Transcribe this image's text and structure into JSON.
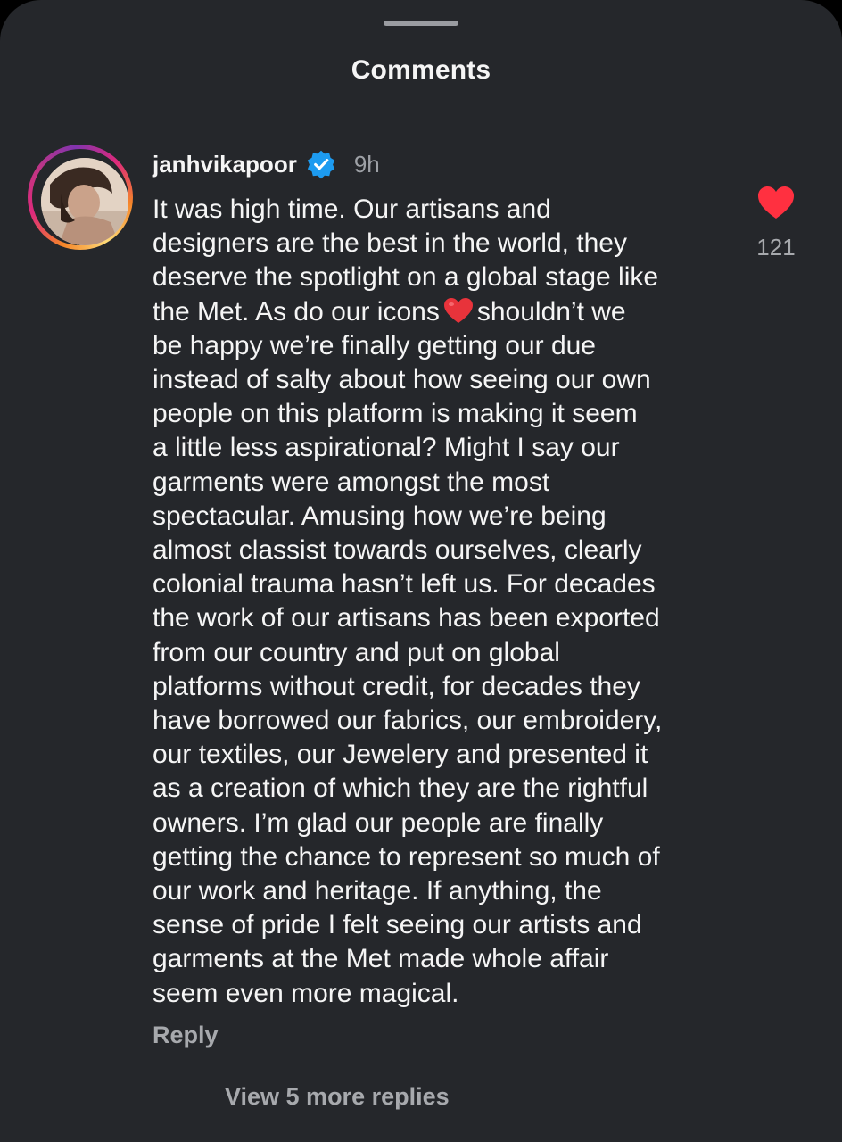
{
  "sheet": {
    "title": "Comments"
  },
  "comment": {
    "username": "janhvikapoor",
    "verified_icon": "verified-badge-icon",
    "time": "9h",
    "lines": [
      "It was high time. Our artisans and",
      "designers are the best in the world, they",
      "deserve the spotlight on a global stage like",
      "the Met. As do our icons",
      "shouldn’t we",
      "be happy we’re finally getting our due",
      "instead of salty about how seeing our own",
      "people on this platform is making it seem",
      "a little less aspirational? Might I say our",
      "garments were amongst the most",
      "spectacular. Amusing how we’re being",
      "almost classist towards ourselves, clearly",
      "colonial trauma hasn’t left us. For decades",
      "the work of our artisans has been exported",
      "from our country and put on global",
      "platforms without credit, for decades they",
      "have borrowed our fabrics, our embroidery,",
      "our textiles, our Jewelery and presented it",
      "as a creation of which they are the rightful",
      "owners. I’m glad our people are finally",
      "getting the chance to represent so much of",
      "our work and heritage. If anything, the",
      "sense of pride I felt seeing our artists and",
      "garments at the Met made whole affair",
      "seem even more magical."
    ],
    "inline_emoji": "red-heart-emoji",
    "reply_label": "Reply",
    "view_more_label": "View 5 more replies",
    "like_count": "121",
    "like_icon": "heart-filled-icon"
  },
  "colors": {
    "background": "#25272b",
    "text": "#f5f5f5",
    "muted": "#a7a9ad",
    "verified": "#1d9bf0",
    "like": "#ff3040"
  }
}
